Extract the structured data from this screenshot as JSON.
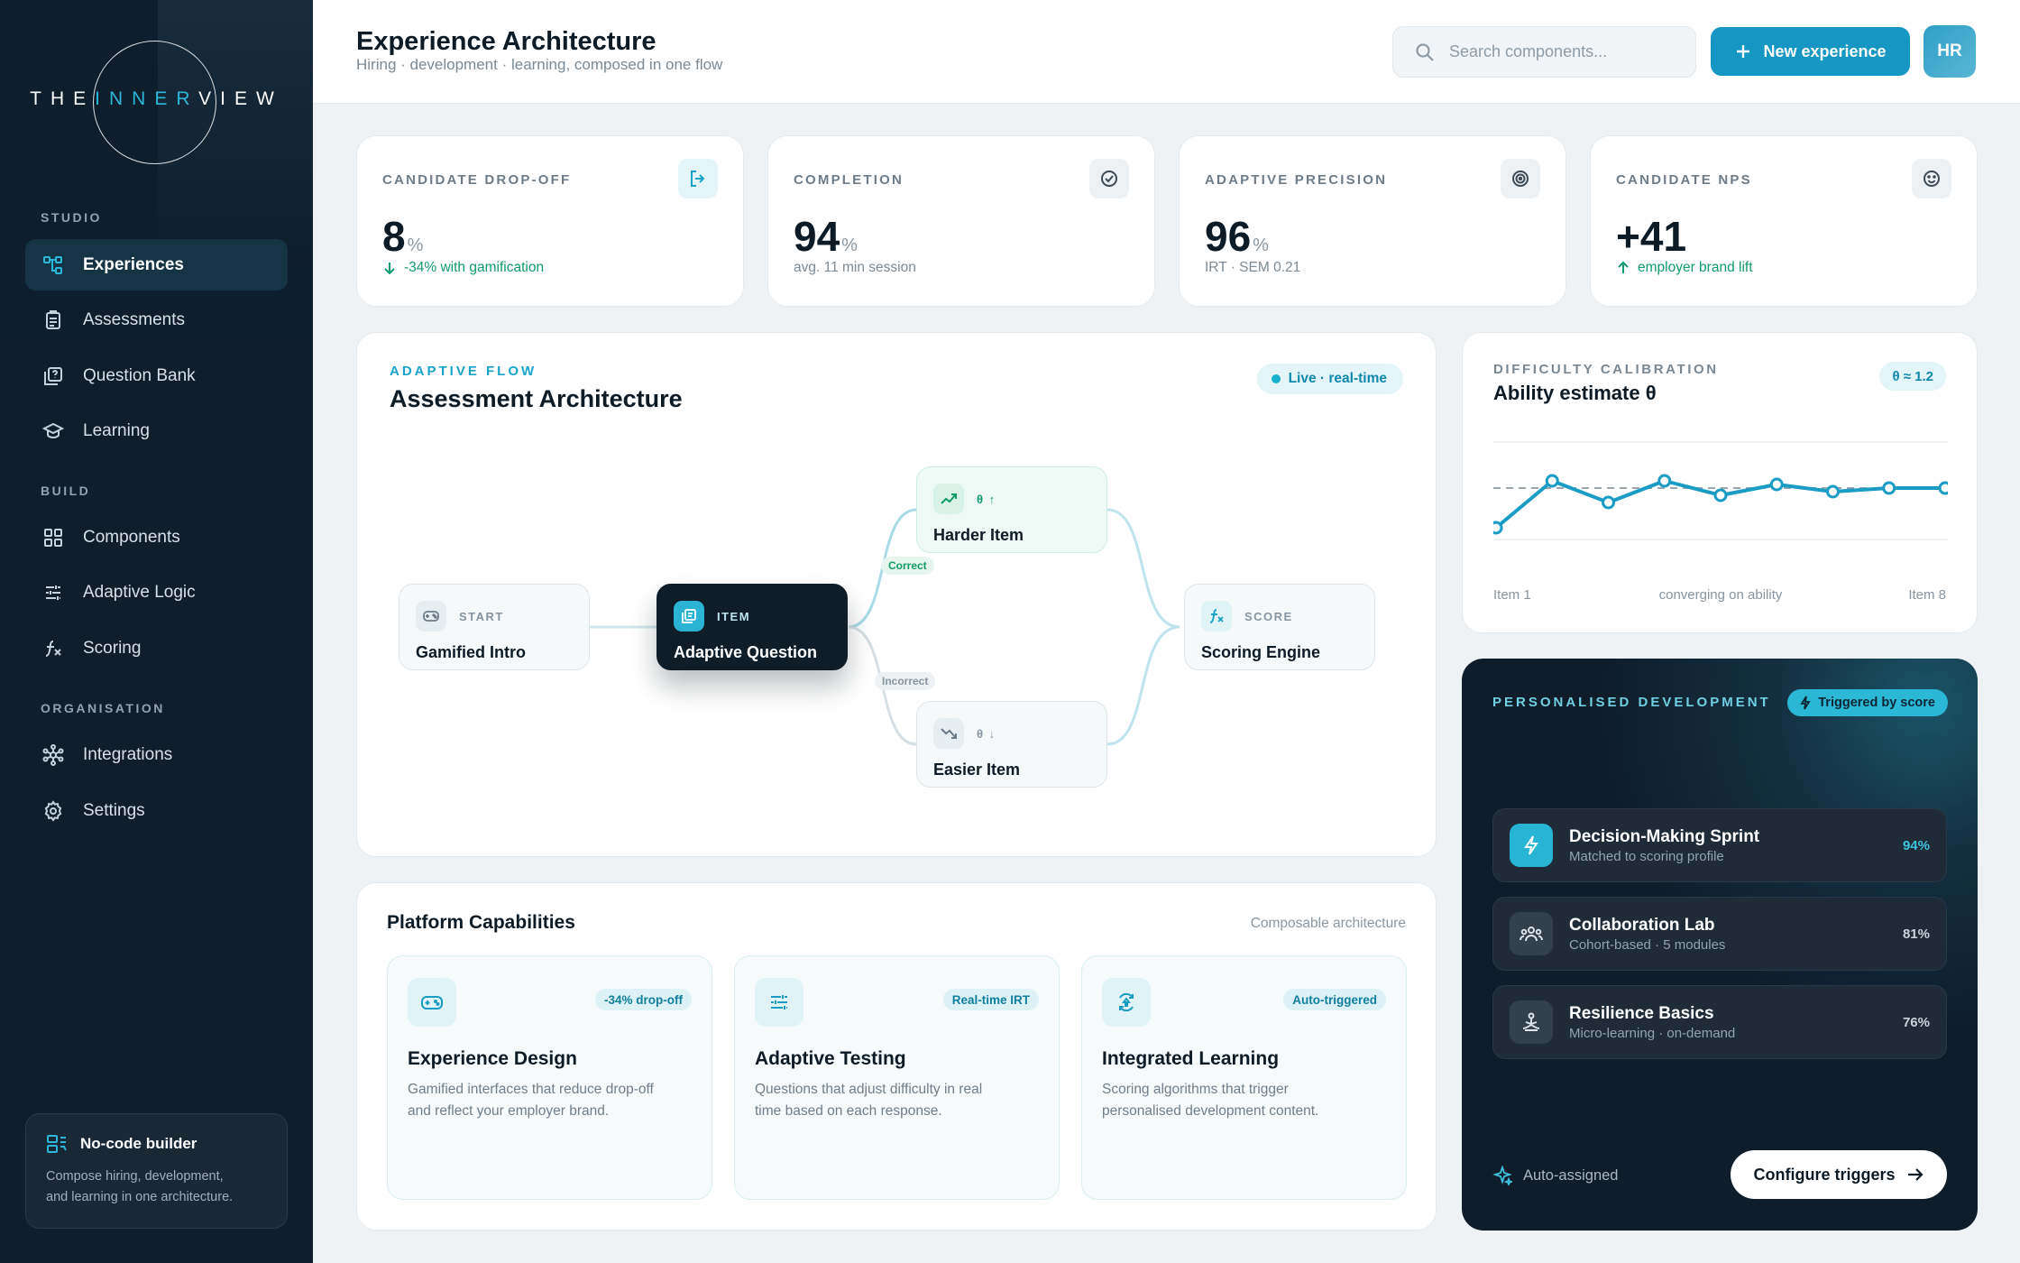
{
  "brand": {
    "logo_prefix": "THE",
    "logo_highlight": "INNER",
    "logo_suffix": "VIEW"
  },
  "sidebar": {
    "sections": [
      {
        "label": "STUDIO",
        "items": [
          {
            "label": "Experiences",
            "icon": "flow-icon",
            "active": true
          },
          {
            "label": "Assessments",
            "icon": "clipboard-icon"
          },
          {
            "label": "Question Bank",
            "icon": "question-box-icon"
          },
          {
            "label": "Learning",
            "icon": "graduation-cap-icon"
          }
        ]
      },
      {
        "label": "BUILD",
        "items": [
          {
            "label": "Components",
            "icon": "grid-icon"
          },
          {
            "label": "Adaptive Logic",
            "icon": "sliders-icon"
          },
          {
            "label": "Scoring",
            "icon": "function-icon"
          }
        ]
      },
      {
        "label": "ORGANISATION",
        "items": [
          {
            "label": "Integrations",
            "icon": "network-icon"
          },
          {
            "label": "Settings",
            "icon": "gear-icon"
          }
        ]
      }
    ],
    "promo": {
      "title": "No-code builder",
      "desc_line1": "Compose hiring, development,",
      "desc_line2": "and learning in one architecture."
    }
  },
  "header": {
    "title": "Experience Architecture",
    "subtitle": "Hiring · development · learning, composed in one flow",
    "search_placeholder": "Search components...",
    "new_button": "New experience",
    "avatar": "HR"
  },
  "kpis": [
    {
      "label": "CANDIDATE DROP-OFF",
      "value": "8",
      "unit": "%",
      "sub": "-34% with gamification",
      "icon": "exit-icon"
    },
    {
      "label": "COMPLETION",
      "value": "94",
      "unit": "%",
      "sub": "avg. 11 min session",
      "icon": "check-circle-icon"
    },
    {
      "label": "ADAPTIVE PRECISION",
      "value": "96",
      "unit": "%",
      "sub": "IRT · SEM 0.21",
      "icon": "target-icon"
    },
    {
      "label": "CANDIDATE NPS",
      "value": "+41",
      "unit": "",
      "sub": "employer brand lift",
      "icon": "smile-icon"
    }
  ],
  "flow": {
    "kicker": "ADAPTIVE FLOW",
    "title": "Assessment Architecture",
    "status": "Live · real-time",
    "nodes": {
      "start": {
        "tag": "START",
        "name": "Gamified Intro"
      },
      "item": {
        "tag": "ITEM",
        "name": "Adaptive Question"
      },
      "harder": {
        "tag": "θ ↑",
        "name": "Harder Item"
      },
      "easier": {
        "tag": "θ ↓",
        "name": "Easier Item"
      },
      "score": {
        "tag": "SCORE",
        "name": "Scoring Engine"
      }
    },
    "edges": {
      "correct": "Correct",
      "incorrect": "Incorrect"
    }
  },
  "calibration": {
    "kicker": "DIFFICULTY CALIBRATION",
    "title": "Ability estimate θ",
    "badge": "θ ≈ 1.2",
    "axis_left": "Item 1",
    "axis_mid": "converging on ability",
    "axis_right": "Item 8"
  },
  "chart_data": {
    "type": "line",
    "x": [
      1,
      2,
      3,
      4,
      5,
      6,
      7,
      8,
      9
    ],
    "series": [
      {
        "values": [
          0.1,
          1.4,
          0.8,
          1.4,
          1.0,
          1.3,
          1.1,
          1.2,
          1.2
        ]
      }
    ],
    "reference_line": 1.2,
    "ylim": [
      0,
      2
    ],
    "grid": true,
    "color": "#1a9cc4"
  },
  "development": {
    "kicker": "PERSONALISED DEVELOPMENT",
    "badge": "Triggered by score",
    "items": [
      {
        "title": "Decision-Making Sprint",
        "sub": "Matched to scoring profile",
        "value": "94%",
        "icon": "lightning-icon",
        "accent": true
      },
      {
        "title": "Collaboration Lab",
        "sub": "Cohort-based · 5 modules",
        "value": "81%",
        "icon": "team-icon"
      },
      {
        "title": "Resilience Basics",
        "sub": "Micro-learning · on-demand",
        "value": "76%",
        "icon": "meditation-icon"
      }
    ],
    "auto_label": "Auto-assigned",
    "button": "Configure triggers"
  },
  "capabilities": {
    "title": "Platform Capabilities",
    "aside": "Composable architecture",
    "cards": [
      {
        "title": "Experience Design",
        "tag": "-34% drop-off",
        "line1": "Gamified interfaces that reduce drop-off",
        "line2": "and reflect your employer brand.",
        "icon": "gamepad-icon"
      },
      {
        "title": "Adaptive Testing",
        "tag": "Real-time IRT",
        "line1": "Questions that adjust difficulty in real",
        "line2": "time based on each response.",
        "icon": "sliders-icon"
      },
      {
        "title": "Integrated Learning",
        "tag": "Auto-triggered",
        "line1": "Scoring algorithms that trigger",
        "line2": "personalised development content.",
        "icon": "learning-icon"
      }
    ]
  },
  "colors": {
    "accent": "#1697c3",
    "sidebar": "#0f1e2c",
    "positive": "#119a6a"
  }
}
